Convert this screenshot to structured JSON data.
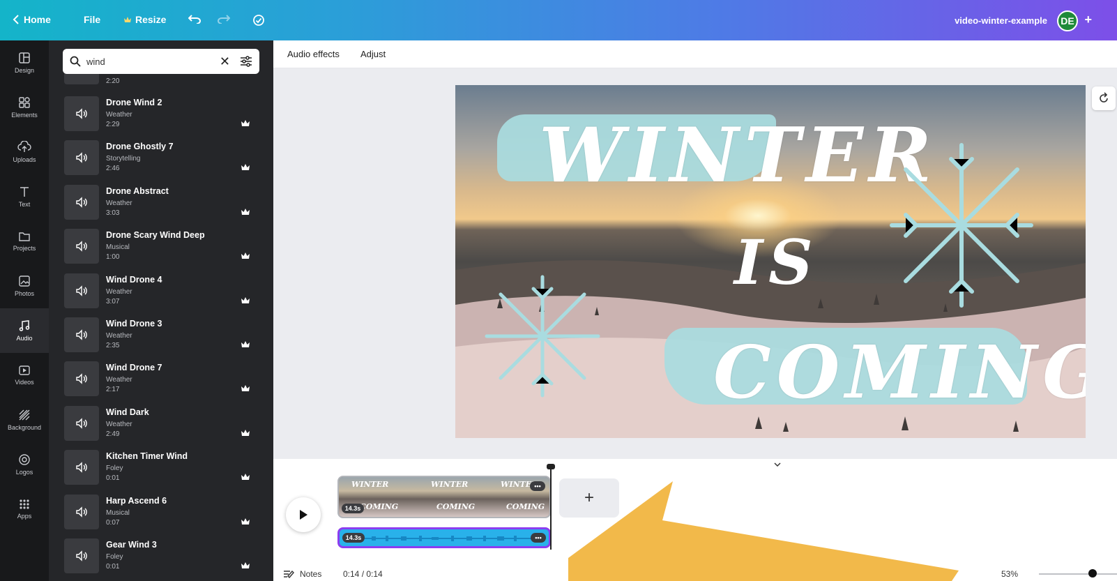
{
  "topbar": {
    "home_label": "Home",
    "file_label": "File",
    "resize_label": "Resize",
    "doc_title": "video-winter-example",
    "avatar_initials": "DE",
    "share_plus": "+"
  },
  "rail": {
    "items": [
      {
        "label": "Design",
        "icon": "layout-icon"
      },
      {
        "label": "Elements",
        "icon": "shapes-icon"
      },
      {
        "label": "Uploads",
        "icon": "cloud-upload-icon"
      },
      {
        "label": "Text",
        "icon": "text-icon"
      },
      {
        "label": "Projects",
        "icon": "folder-icon"
      },
      {
        "label": "Photos",
        "icon": "image-icon"
      },
      {
        "label": "Audio",
        "icon": "music-note-icon"
      },
      {
        "label": "Videos",
        "icon": "video-icon"
      },
      {
        "label": "Background",
        "icon": "pattern-icon"
      },
      {
        "label": "Logos",
        "icon": "logo-icon"
      },
      {
        "label": "Apps",
        "icon": "grid-icon"
      }
    ],
    "active": "Audio"
  },
  "search": {
    "value": "wind",
    "clear_glyph": "✕"
  },
  "audio_list": {
    "partial_duration": "2:20",
    "items": [
      {
        "title": "Drone Wind 2",
        "category": "Weather",
        "duration": "2:29"
      },
      {
        "title": "Drone Ghostly 7",
        "category": "Storytelling",
        "duration": "2:46"
      },
      {
        "title": "Drone Abstract",
        "category": "Weather",
        "duration": "3:03"
      },
      {
        "title": "Drone Scary Wind Deep",
        "category": "Musical",
        "duration": "1:00"
      },
      {
        "title": "Wind Drone 4",
        "category": "Weather",
        "duration": "3:07"
      },
      {
        "title": "Wind Drone 3",
        "category": "Weather",
        "duration": "2:35"
      },
      {
        "title": "Wind Drone 7",
        "category": "Weather",
        "duration": "2:17"
      },
      {
        "title": "Wind Dark",
        "category": "Weather",
        "duration": "2:49"
      },
      {
        "title": "Kitchen Timer Wind",
        "category": "Foley",
        "duration": "0:01"
      },
      {
        "title": "Harp Ascend 6",
        "category": "Musical",
        "duration": "0:07"
      },
      {
        "title": "Gear Wind 3",
        "category": "Foley",
        "duration": "0:01"
      }
    ]
  },
  "editor_toolbar": {
    "audio_effects": "Audio effects",
    "adjust": "Adjust"
  },
  "design": {
    "word1": "WINTER",
    "word2": "IS",
    "word3": "COMING"
  },
  "timeline": {
    "clip_duration": "14.3s",
    "audio_duration": "14.3s",
    "more_glyph": "•••",
    "add_glyph": "+"
  },
  "footer": {
    "notes_label": "Notes",
    "time": "0:14 / 0:14",
    "zoom": "53%"
  },
  "colors": {
    "accent_purple": "#8b3df0",
    "audio_track": "#29b1ea",
    "arrow": "#f2b94a",
    "brush": "#a9dce0"
  }
}
